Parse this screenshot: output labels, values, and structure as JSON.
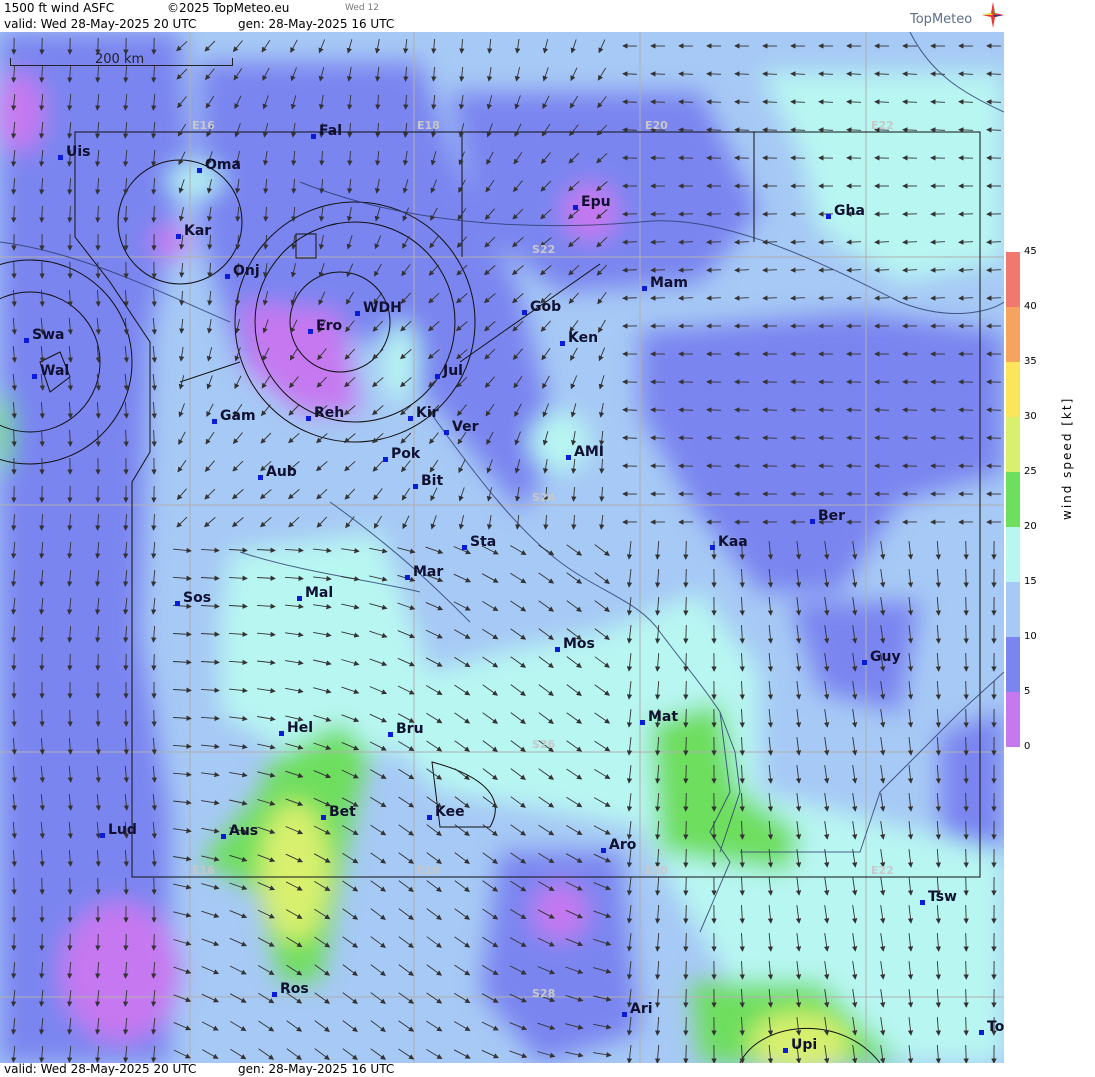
{
  "header": {
    "product": "1500 ft wind ASFC",
    "copyright": "©2025 TopMeteo.eu",
    "weekday_tag": "Wed 12",
    "valid": "valid:  Wed  28-May-2025  20 UTC",
    "generated": "gen: 28-May-2025 16 UTC"
  },
  "footer": {
    "valid": "valid:  Wed  28-May-2025  20 UTC",
    "generated": "gen: 28-May-2025 16 UTC"
  },
  "logo": {
    "text": "TopMeteo",
    "icon": "compass-star-icon"
  },
  "scale": {
    "label": "200 km"
  },
  "grid_labels": {
    "e16_top": "E16",
    "e18_top": "E18",
    "e20_top": "E20",
    "e22_top": "E22",
    "e16_bot": "E16",
    "e18_bot": "E18",
    "e20_bot": "E20",
    "e22_bot": "E22",
    "s22": "S22",
    "s24": "S24",
    "s26": "S26",
    "s28": "S28"
  },
  "places": [
    "Uis",
    "Oma",
    "Fal",
    "Kar",
    "Onj",
    "Swa",
    "Wal",
    "Ero",
    "WDH",
    "Epu",
    "Gha",
    "Mam",
    "Gob",
    "Ken",
    "Jul",
    "Gam",
    "Reh",
    "Kir",
    "Ver",
    "Pok",
    "AMI",
    "Bit",
    "Aub",
    "Sta",
    "Ber",
    "Kaa",
    "Mar",
    "Mal",
    "Sos",
    "Mos",
    "Guy",
    "Mat",
    "Hel",
    "Bru",
    "Bet",
    "Kee",
    "Lud",
    "Aus",
    "Aro",
    "Tsw",
    "Ros",
    "Ari",
    "Upi",
    "To"
  ],
  "legend": {
    "title": "wind  speed  [kt]",
    "ticks": [
      "45",
      "40",
      "35",
      "30",
      "25",
      "20",
      "15",
      "10",
      "5",
      "0"
    ],
    "colors": [
      "#f0786e",
      "#f5a35e",
      "#fbe55a",
      "#d8f06e",
      "#6ede5e",
      "#b8f6f2",
      "#a6c9f5",
      "#7a85f0",
      "#c678f0"
    ]
  }
}
